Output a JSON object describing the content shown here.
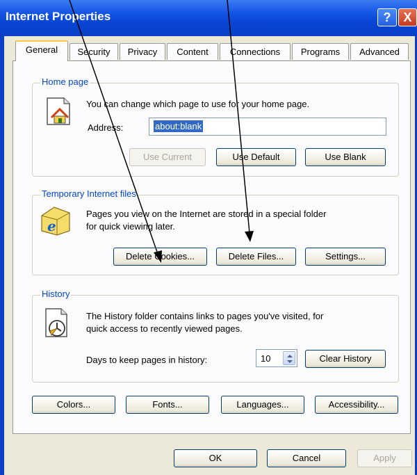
{
  "window": {
    "title": "Internet Properties",
    "help_glyph": "?",
    "close_glyph": "X"
  },
  "tabs": [
    "General",
    "Security",
    "Privacy",
    "Content",
    "Connections",
    "Programs",
    "Advanced"
  ],
  "home_page": {
    "legend": "Home page",
    "description": "You can change which page to use for your home page.",
    "address_label": "Address:",
    "address_value": "about:blank",
    "buttons": {
      "use_current": "Use Current",
      "use_default": "Use Default",
      "use_blank": "Use Blank"
    },
    "icon": "home-page-icon"
  },
  "temp_files": {
    "legend": "Temporary Internet files",
    "line1": "Pages you view on the Internet are stored in a special folder",
    "line2": "for quick viewing later.",
    "buttons": {
      "delete_cookies": "Delete Cookies...",
      "delete_files": "Delete Files...",
      "settings": "Settings..."
    },
    "icon": "ie-folder-icon"
  },
  "history": {
    "legend": "History",
    "line1": "The History folder contains links to pages you've visited, for",
    "line2": "quick access to recently viewed pages.",
    "days_label": "Days to keep pages in history:",
    "days_value": "10",
    "clear_button": "Clear History",
    "icon": "history-icon"
  },
  "bottom_buttons": {
    "colors": "Colors...",
    "fonts": "Fonts...",
    "languages": "Languages...",
    "accessibility": "Accessibility..."
  },
  "dialog_buttons": {
    "ok": "OK",
    "cancel": "Cancel",
    "apply": "Apply"
  },
  "colors": {
    "titlebar": "#0a3fc6",
    "legend": "#0046d5",
    "dialog_bg": "#ece9d8",
    "selection": "#316ac5"
  }
}
